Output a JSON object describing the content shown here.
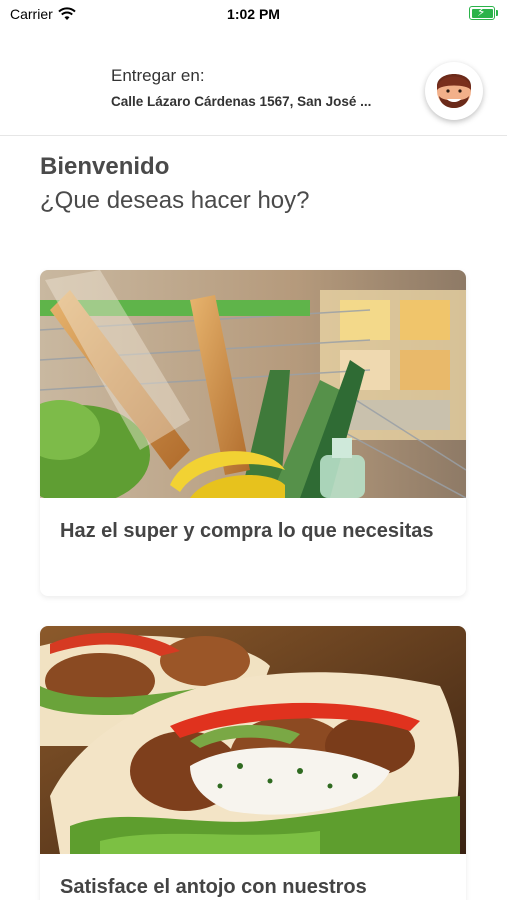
{
  "status_bar": {
    "carrier": "Carrier",
    "time": "1:02 PM",
    "battery_level": 0.9,
    "battery_color": "#2bb34a"
  },
  "header": {
    "deliver_label": "Entregar en:",
    "address": "Calle Lázaro Cárdenas 1567, San José ..."
  },
  "greeting": {
    "title": "Bienvenido",
    "subtitle": "¿Que deseas hacer hoy?"
  },
  "cards": [
    {
      "label": "Haz el super y compra lo que necesitas",
      "image": "grocery-cart-photo"
    },
    {
      "label": "Satisface el antojo con nuestros",
      "image": "falafel-pita-photo"
    }
  ],
  "colors": {
    "text": "#4a4a4a",
    "divider": "#e6e6e6"
  }
}
